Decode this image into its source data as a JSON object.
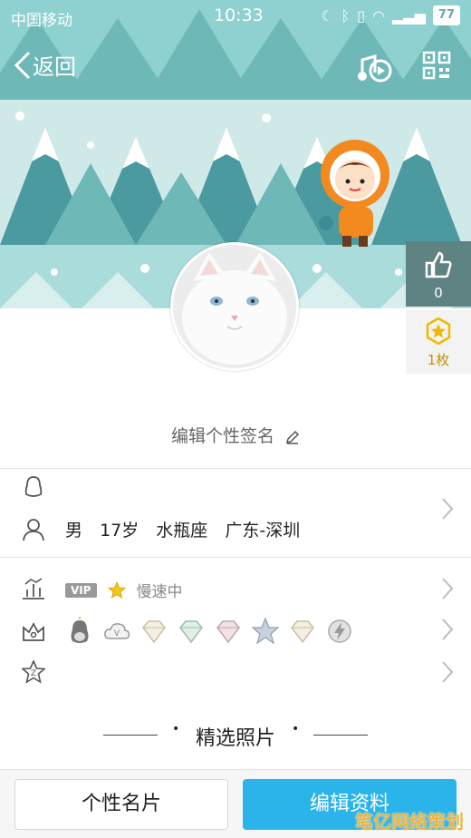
{
  "status_bar": {
    "carrier": "中国移动",
    "time": "10:33",
    "battery": "77"
  },
  "nav": {
    "back_label": "返回",
    "music_icon": "music-disc-icon",
    "qr_icon": "qr-code-icon"
  },
  "profile": {
    "avatar_icon": "white-cat-avatar",
    "likes": "0",
    "badge_count": "1枚",
    "signature": "编辑个性签名"
  },
  "info": {
    "gender": "男",
    "age": "17岁",
    "zodiac": "水瓶座",
    "location": "广东-深圳"
  },
  "level": {
    "vip": "VIP",
    "status": "慢速中"
  },
  "medals": [
    "penguin",
    "cloud",
    "diamond",
    "diamond-green",
    "diamond-pink",
    "star",
    "diamond",
    "speed"
  ],
  "section_title": "精选照片",
  "bottom": {
    "card_button": "个性名片",
    "edit_button": "编辑资料"
  },
  "watermark": "笔亿网络策划",
  "colors": {
    "banner": "#8fd0d0",
    "accent": "#2bb4ea",
    "like_box": "#5f8283",
    "badge_gold": "#f0b800"
  }
}
